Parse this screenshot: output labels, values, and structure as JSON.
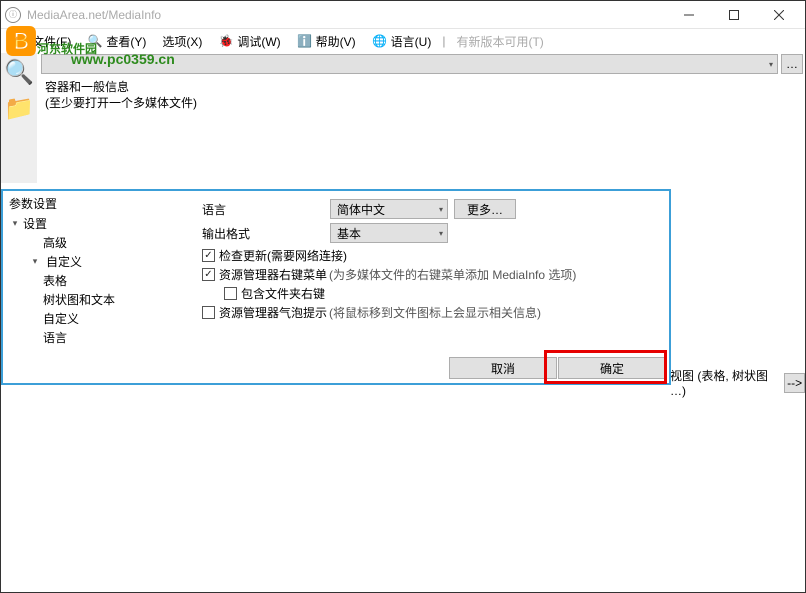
{
  "titlebar": {
    "text": "MediaArea.net/MediaInfo"
  },
  "menus": {
    "file": "文件(F)",
    "view": "查看(Y)",
    "options": "选项(X)",
    "debug": "调试(W)",
    "help": "帮助(V)",
    "language": "语言(U)",
    "update": "有新版本可用(T)"
  },
  "watermark": {
    "text": "河东软件园",
    "url": "www.pc0359.cn"
  },
  "info": {
    "line1": "容器和一般信息",
    "line2": "(至少要打开一个多媒体文件)"
  },
  "dialog": {
    "title": "参数设置",
    "tree": {
      "settings": "设置",
      "advanced": "高级",
      "custom": "自定义",
      "table": "表格",
      "treeAndText": "树状图和文本",
      "customSub": "自定义",
      "lang": "语言"
    },
    "form": {
      "langLabel": "语言",
      "langValue": "简体中文",
      "moreBtn": "更多…",
      "formatLabel": "输出格式",
      "formatValue": "基本",
      "chkUpdate": "检查更新(需要网络连接)",
      "chkExplorer": "资源管理器右键菜单",
      "chkExplorerNote": "(为多媒体文件的右键菜单添加 MediaInfo 选项)",
      "chkFolder": "包含文件夹右键",
      "chkTooltip": "资源管理器气泡提示",
      "chkTooltipNote": "(将鼠标移到文件图标上会显示相关信息)"
    },
    "buttons": {
      "cancel": "取消",
      "ok": "确定"
    }
  },
  "bottom": {
    "text": "视图 (表格, 树状图 …)",
    "arrow": "-->"
  }
}
